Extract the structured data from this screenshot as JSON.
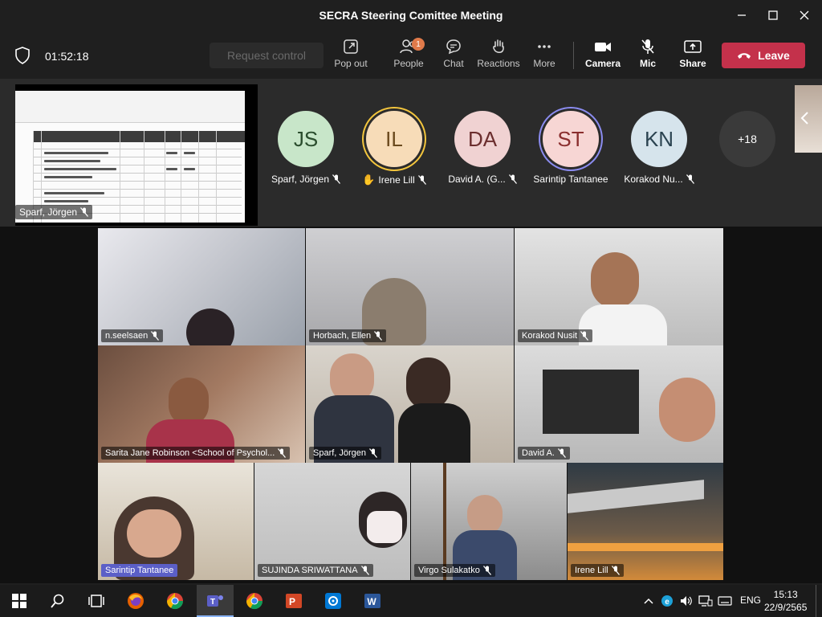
{
  "window": {
    "title": "SECRA Steering Comittee Meeting"
  },
  "toolbar": {
    "timer": "01:52:18",
    "request_control": "Request control",
    "pop_out": "Pop out",
    "people": "People",
    "people_badge": "1",
    "chat": "Chat",
    "reactions": "Reactions",
    "more": "More",
    "camera": "Camera",
    "mic": "Mic",
    "share": "Share",
    "leave": "Leave"
  },
  "share": {
    "presenter": "Sparf, Jörgen"
  },
  "strip": {
    "participants": [
      {
        "initials": "JS",
        "name": "Sparf, Jörgen",
        "color": "#c8e6c9"
      },
      {
        "initials": "IL",
        "name": "Irene Lill",
        "color": "#f7dcb8",
        "hand": true
      },
      {
        "initials": "DA",
        "name": "David A. (G...",
        "color": "#f0d2d2"
      },
      {
        "initials": "ST",
        "name": "Sarintip Tantanee",
        "color": "#f7d6d4"
      },
      {
        "initials": "KN",
        "name": "Korakod Nu...",
        "color": "#d6e4ec"
      }
    ],
    "overflow": "+18"
  },
  "tiles": [
    {
      "name": "n.seelsaen"
    },
    {
      "name": "Horbach, Ellen"
    },
    {
      "name": "Korakod Nusit"
    },
    {
      "name": "Sarita Jane Robinson <School of Psychol..."
    },
    {
      "name": "Sparf, Jörgen"
    },
    {
      "name": "David A."
    },
    {
      "name": "Sarintip Tantanee"
    },
    {
      "name": "SUJINDA SRIWATTANA"
    },
    {
      "name": "Virgo Sulakatko"
    },
    {
      "name": "Irene Lill"
    }
  ],
  "taskbar": {
    "language": "ENG",
    "time": "15:13",
    "date": "22/9/2565"
  },
  "colors": {
    "leave": "#c4314b",
    "background": "#1f1f1f",
    "highlight_ring": "#f4c63d"
  }
}
